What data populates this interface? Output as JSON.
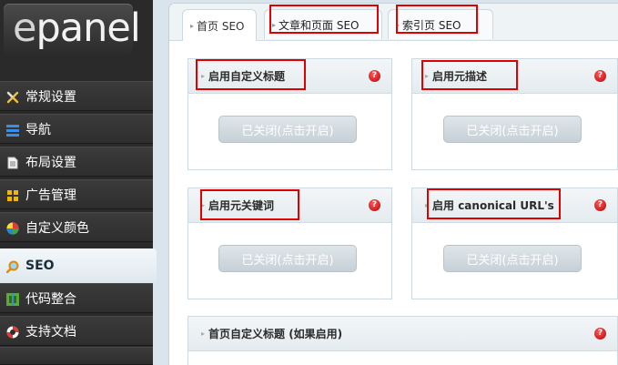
{
  "logo": {
    "text_e": "e",
    "text_rest": "panel"
  },
  "sidebar": {
    "items": [
      {
        "label": "常规设置",
        "icon": "wrench-icon"
      },
      {
        "label": "导航",
        "icon": "menu-icon"
      },
      {
        "label": "布局设置",
        "icon": "document-icon"
      },
      {
        "label": "广告管理",
        "icon": "grid-icon"
      },
      {
        "label": "自定义颜色",
        "icon": "color-wheel-icon"
      },
      {
        "label": "SEO",
        "icon": "magnifier-icon",
        "active": true
      },
      {
        "label": "代码整合",
        "icon": "code-icon"
      },
      {
        "label": "支持文档",
        "icon": "lifebuoy-icon"
      }
    ]
  },
  "tabs": [
    {
      "label": "首页 SEO",
      "active": true
    },
    {
      "label": "文章和页面 SEO"
    },
    {
      "label": "索引页 SEO"
    }
  ],
  "panels": [
    {
      "title": "启用自定义标题",
      "button": "已关闭(点击开启)"
    },
    {
      "title": "启用元描述",
      "button": "已关闭(点击开启)"
    },
    {
      "title": "启用元关键词",
      "button": "已关闭(点击开启)"
    },
    {
      "title": "启用 canonical URL's",
      "button": "已关闭(点击开启)"
    },
    {
      "title": "首页自定义标题 (如果启用)"
    }
  ],
  "help_glyph": "?",
  "bullet": "▸",
  "colors": {
    "highlight": "#e10000",
    "help": "#c40000",
    "sidebar": "#2a2a2a"
  }
}
